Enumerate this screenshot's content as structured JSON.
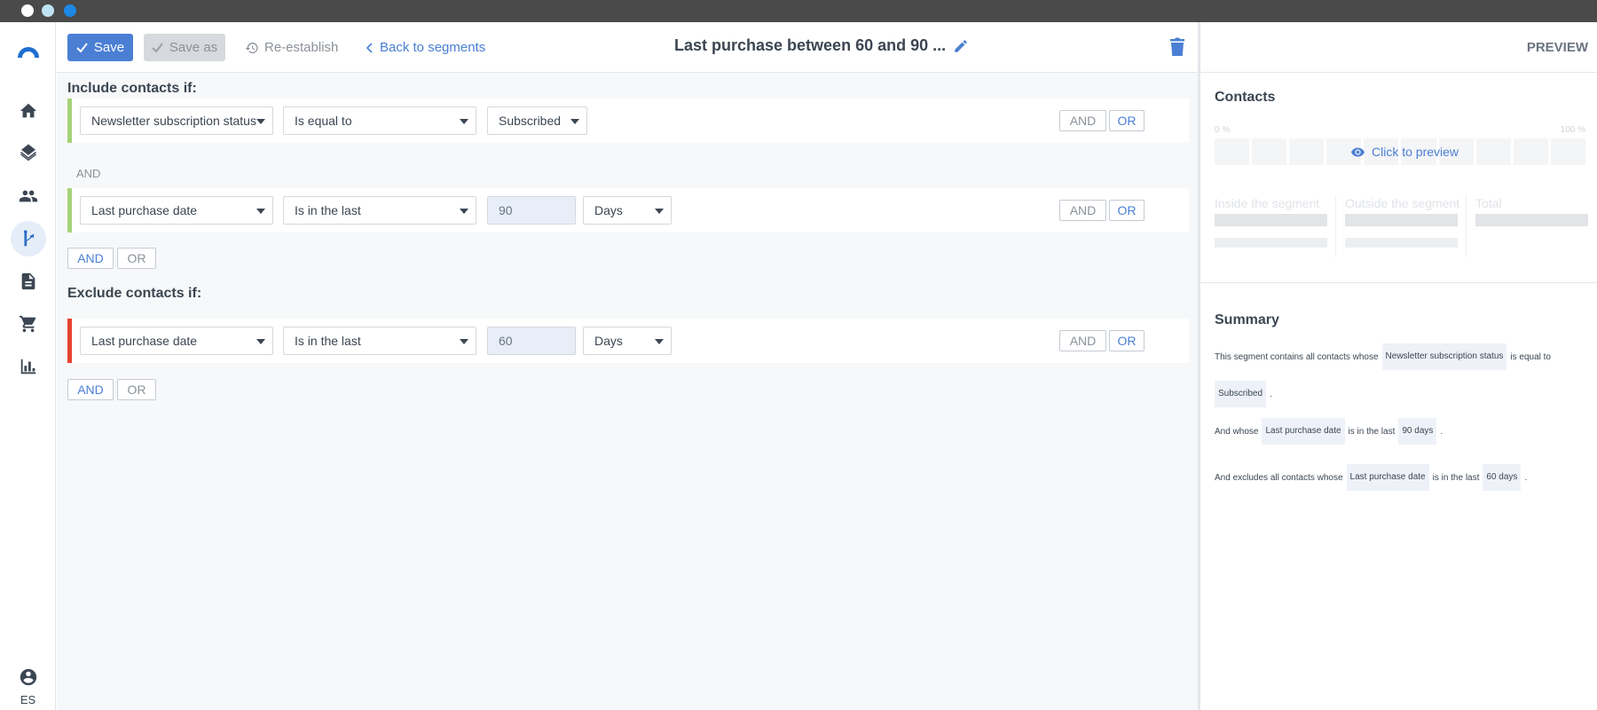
{
  "window": {
    "title": ""
  },
  "nav": {
    "items": [
      {
        "name": "home",
        "icon": "home-icon"
      },
      {
        "name": "layers",
        "icon": "layers-icon"
      },
      {
        "name": "contacts",
        "icon": "people-icon"
      },
      {
        "name": "segments",
        "icon": "fork-icon",
        "active": true
      },
      {
        "name": "documents",
        "icon": "document-icon"
      },
      {
        "name": "shop",
        "icon": "cart-icon"
      },
      {
        "name": "reports",
        "icon": "bar-chart-icon"
      }
    ],
    "language": "ES"
  },
  "toolbar": {
    "save_label": "Save",
    "save_as_label": "Save as",
    "reestablish_label": "Re-establish",
    "back_label": "Back to segments",
    "segment_title": "Last purchase between 60 and 90 ..."
  },
  "include": {
    "title": "Include contacts if:",
    "connector": "AND",
    "rules": [
      {
        "field": "Newsletter subscription status",
        "operator": "Is equal to",
        "value": "Subscribed",
        "bar_color": "#a5d27a"
      },
      {
        "field": "Last purchase date",
        "operator": "Is in the last",
        "value": "90",
        "unit": "Days",
        "bar_color": "#a5d27a"
      }
    ],
    "add_and": "AND",
    "add_or": "OR"
  },
  "exclude": {
    "title": "Exclude contacts if:",
    "rules": [
      {
        "field": "Last purchase date",
        "operator": "Is in the last",
        "value": "60",
        "unit": "Days",
        "bar_color": "#e8432e"
      }
    ],
    "add_and": "AND",
    "add_or": "OR"
  },
  "rule_buttons": {
    "and": "AND",
    "or": "OR"
  },
  "preview": {
    "label": "PREVIEW",
    "contacts_title": "Contacts",
    "pct_min": "0 %",
    "pct_max": "100 %",
    "click_to_preview": "Click to preview",
    "inside": "Inside the segment",
    "outside": "Outside the segment",
    "total": "Total"
  },
  "summary": {
    "title": "Summary",
    "l1_text": "This segment contains all contacts whose",
    "l1_chip": "Newsletter subscription status",
    "l1_tail": "is equal to",
    "l2_chip": "Subscribed",
    "l2_tail": ".",
    "l3_text": "And whose",
    "l3_chip1": "Last purchase date",
    "l3_mid": "is in the last",
    "l3_chip2": "90 days",
    "l3_tail": ".",
    "l4_text": "And excludes all contacts whose",
    "l4_chip1": "Last purchase date",
    "l4_mid": "is in the last",
    "l4_chip2": "60 days",
    "l4_tail": "."
  },
  "colors": {
    "accent": "#4a7fd4",
    "include_bar": "#a5d27a",
    "exclude_bar": "#e8432e"
  }
}
